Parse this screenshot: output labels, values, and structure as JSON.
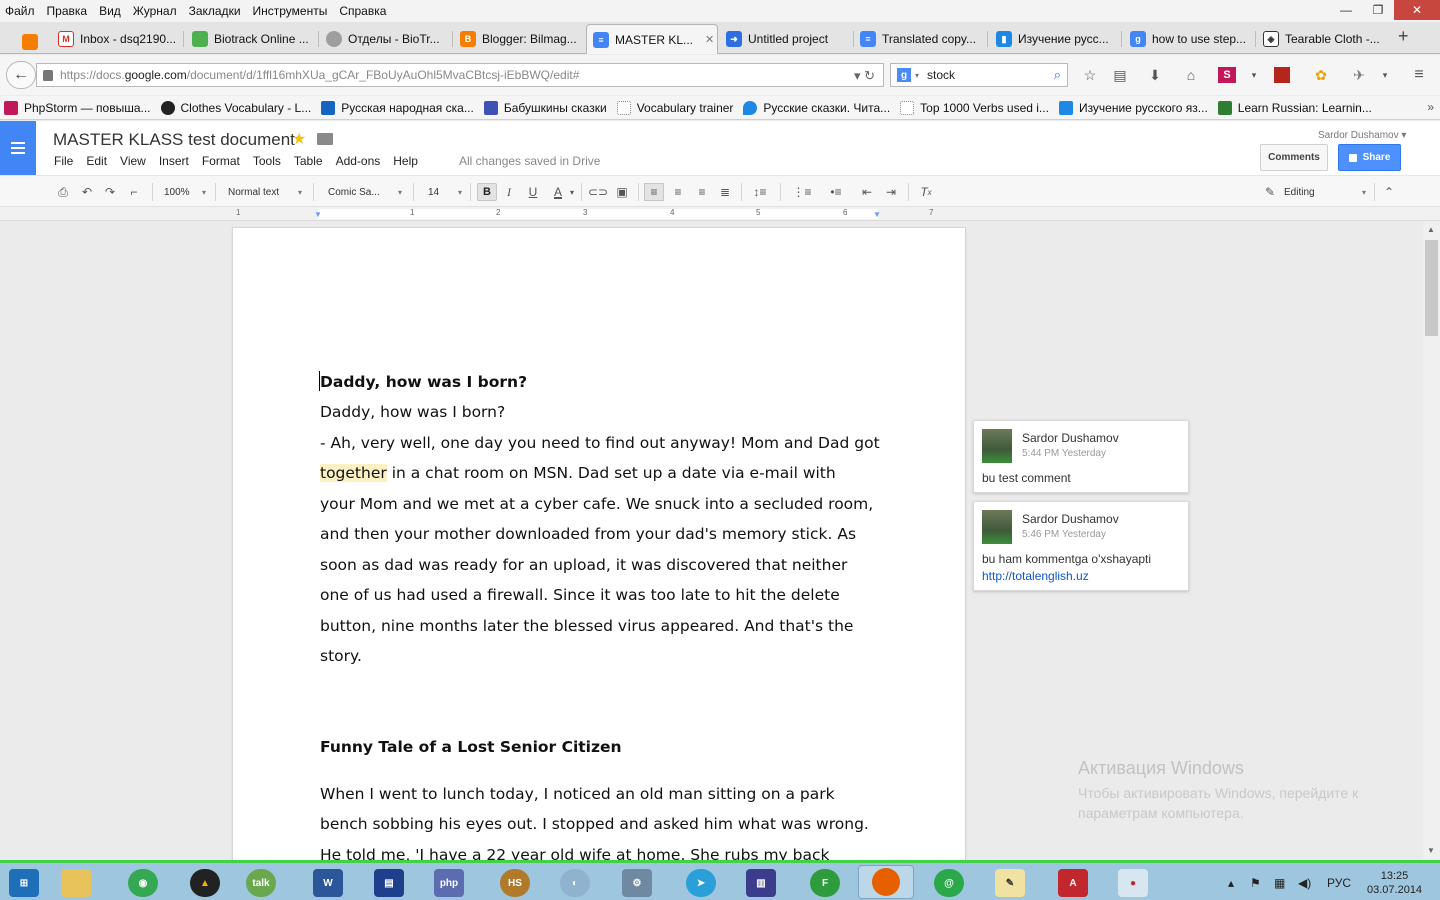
{
  "menubar": {
    "items": [
      "Файл",
      "Правка",
      "Вид",
      "Журнал",
      "Закладки",
      "Инструменты",
      "Справка"
    ]
  },
  "tabs": [
    {
      "label": "Inbox - dsq2190...",
      "icon": "gmail-icon",
      "color": "#d93025"
    },
    {
      "label": "Biotrack Online ...",
      "icon": "biotrack-icon",
      "color": "#4caf50"
    },
    {
      "label": "Отделы - BioTr...",
      "icon": "biotrack-dept-icon",
      "color": "#9e9e9e"
    },
    {
      "label": "Blogger: Bilmag...",
      "icon": "blogger-icon",
      "color": "#f57d00"
    },
    {
      "label": "MASTER KL...",
      "icon": "docs-icon",
      "color": "#4285f4",
      "active": true
    },
    {
      "label": "Untitled project",
      "icon": "arrow-icon",
      "color": "#2d6ee0"
    },
    {
      "label": "Translated copy...",
      "icon": "docs-icon",
      "color": "#4285f4"
    },
    {
      "label": "Изучение русс...",
      "icon": "bar-chart-icon",
      "color": "#1e88e5"
    },
    {
      "label": "how to use step...",
      "icon": "google-icon",
      "color": "#4285f4"
    },
    {
      "label": "Tearable Cloth -...",
      "icon": "codepen-icon",
      "color": "#333333"
    }
  ],
  "nav": {
    "url_prefix": "https://docs.",
    "url_host": "google.com",
    "url_path": "/document/d/1ffl16mhXUa_gCAr_FBoUyAuOhl5MvaCBtcsj-iEbBWQ/edit#",
    "search_value": "stock"
  },
  "bookmarks": [
    {
      "label": "PhpStorm — повыша...",
      "color": "#c2185b"
    },
    {
      "label": "Clothes Vocabulary - L...",
      "color": "#222222"
    },
    {
      "label": "Русская народная ска...",
      "color": "#1565c0"
    },
    {
      "label": "Бабушкины сказки",
      "color": "#3f51b5"
    },
    {
      "label": "Vocabulary trainer",
      "color": "#ffffff"
    },
    {
      "label": "Русские сказки. Чита...",
      "color": "#1e88e5"
    },
    {
      "label": "Top 1000 Verbs used i...",
      "color": "#ffffff"
    },
    {
      "label": "Изучение русского яз...",
      "color": "#1e88e5"
    },
    {
      "label": "Learn Russian: Learnin...",
      "color": "#2e7d32"
    }
  ],
  "doc": {
    "title": "MASTER KLASS test document",
    "menu": [
      "File",
      "Edit",
      "View",
      "Insert",
      "Format",
      "Tools",
      "Table",
      "Add-ons",
      "Help"
    ],
    "save_status": "All changes saved in Drive",
    "user": "Sardor Dushamov ▾",
    "comments_label": "Comments",
    "share_label": "Share"
  },
  "toolbar": {
    "zoom": "100%",
    "style": "Normal text",
    "font": "Comic Sa...",
    "size": "14",
    "mode": "Editing"
  },
  "ruler": [
    "1",
    "1",
    "2",
    "3",
    "4",
    "5",
    "6",
    "7"
  ],
  "content": {
    "heading1": "Daddy, how was I born?",
    "lines1": [
      "Daddy, how was I born?",
      "- Ah, very well, one day you need to find out anyway! Mom and Dad got",
      "in a chat room on MSN. Dad set up a date via e-mail with",
      "your Mom and we met at a cyber cafe. We snuck into a secluded room,",
      "and then your mother downloaded from your dad's memory stick. As",
      "soon as dad was ready for an upload, it was discovered that neither",
      "one of us had used a firewall. Since it was too late to hit the delete",
      "button, nine months later the blessed virus appeared. And that's the",
      "story."
    ],
    "highlight_word": "together",
    "heading2": "Funny Tale of a Lost Senior Citizen",
    "lines2": [
      "When I went to lunch today, I noticed an old man sitting on a park",
      "bench sobbing his eyes out. I stopped and asked him what was wrong.",
      "He told me, 'I have a 22 year old wife at home. She rubs my back"
    ]
  },
  "comments": [
    {
      "author": "Sardor Dushamov",
      "time": "5:44 PM Yesterday",
      "text": "bu test comment",
      "link": ""
    },
    {
      "author": "Sardor Dushamov",
      "time": "5:46 PM Yesterday",
      "text": "bu ham kommentga o'xshayapti",
      "link": "http://totalenglish.uz"
    }
  ],
  "watermark": {
    "title": "Активация Windows",
    "line1": "Чтобы активировать Windows, перейдите к",
    "line2": "параметрам компьютера."
  },
  "taskbar": {
    "lang": "РУС",
    "time": "13:25",
    "date": "03.07.2014"
  }
}
